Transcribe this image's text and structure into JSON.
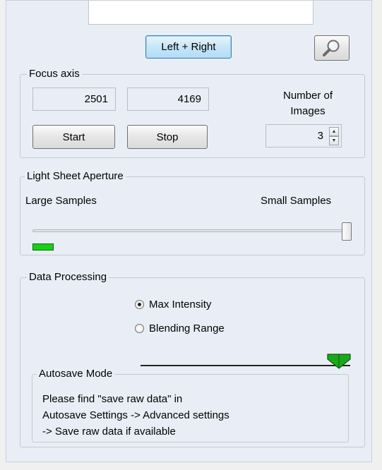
{
  "toolbar": {
    "left_right_label": "Left + Right",
    "magnifier_icon": "magnifier-icon"
  },
  "focus_axis": {
    "title": "Focus axis",
    "start_value": "2501",
    "stop_value": "4169",
    "start_label": "Start",
    "stop_label": "Stop",
    "num_images_label_line1": "Number of",
    "num_images_label_line2": "Images",
    "num_images_value": "3"
  },
  "light_sheet": {
    "title": "Light Sheet Aperture",
    "left_label": "Large Samples",
    "right_label": "Small Samples",
    "slider_value": 1.0,
    "indicator_color": "#18d018"
  },
  "data_processing": {
    "title": "Data Processing",
    "options": [
      {
        "label": "Max Intensity",
        "selected": true
      },
      {
        "label": "Blending Range",
        "selected": false
      }
    ],
    "marker_color": "#1aa81a"
  },
  "autosave": {
    "title": "Autosave Mode",
    "line1": "Please find \"save raw data\" in",
    "line2": "Autosave Settings -> Advanced settings",
    "line3": "-> Save raw data if available"
  }
}
